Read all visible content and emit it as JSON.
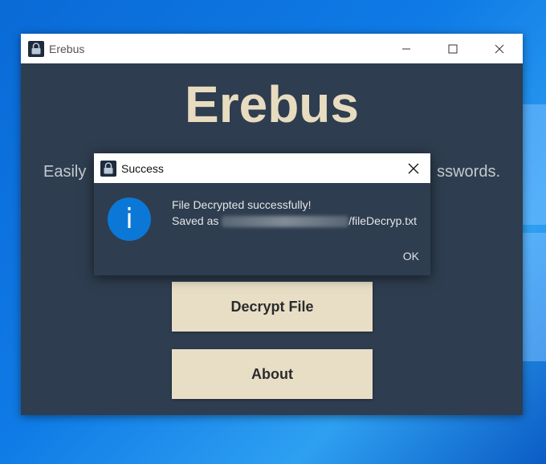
{
  "window": {
    "title": "Erebus",
    "minimize_icon": "minimize-icon",
    "maximize_icon": "maximize-icon",
    "close_icon": "close-icon"
  },
  "app": {
    "heading": "Erebus",
    "tagline_left": "Easily",
    "tagline_right": "sswords.",
    "buttons": {
      "decrypt": "Decrypt File",
      "about": "About"
    }
  },
  "dialog": {
    "title": "Success",
    "icon": "info-icon",
    "line1": "File Decrypted successfully!",
    "line2_prefix": "Saved as",
    "line2_suffix": "/fileDecryp.txt",
    "ok": "OK"
  },
  "colors": {
    "window_bg": "#2e3d4f",
    "heading": "#e8dcc0",
    "button_bg": "#e8dec6",
    "info_blue": "#0b78d7"
  }
}
